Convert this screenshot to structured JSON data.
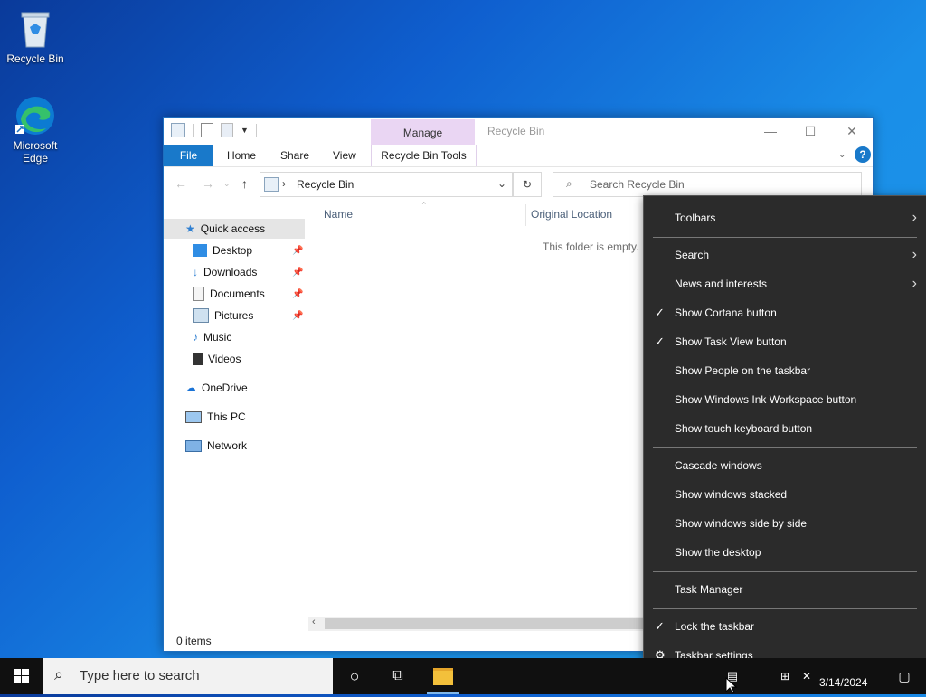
{
  "desktop": {
    "icons": [
      {
        "label": "Recycle Bin"
      },
      {
        "label": "Microsoft Edge"
      }
    ]
  },
  "explorer": {
    "title": "Recycle Bin",
    "manage_tab": "Manage",
    "ribbon_tabs": {
      "file": "File",
      "home": "Home",
      "share": "Share",
      "view": "View",
      "tools": "Recycle Bin Tools"
    },
    "address": "Recycle Bin",
    "search_placeholder": "Search Recycle Bin",
    "nav": {
      "quick_access": "Quick access",
      "desktop": "Desktop",
      "downloads": "Downloads",
      "documents": "Documents",
      "pictures": "Pictures",
      "music": "Music",
      "videos": "Videos",
      "onedrive": "OneDrive",
      "this_pc": "This PC",
      "network": "Network"
    },
    "columns": {
      "name": "Name",
      "original_location": "Original Location"
    },
    "empty_message": "This folder is empty.",
    "status": "0 items"
  },
  "context_menu": {
    "toolbars": "Toolbars",
    "search": "Search",
    "news": "News and interests",
    "cortana": "Show Cortana button",
    "task_view": "Show Task View button",
    "people": "Show People on the taskbar",
    "ink": "Show Windows Ink Workspace button",
    "touch_keyboard": "Show touch keyboard button",
    "cascade": "Cascade windows",
    "stacked": "Show windows stacked",
    "side_by_side": "Show windows side by side",
    "show_desktop": "Show the desktop",
    "task_manager": "Task Manager",
    "lock": "Lock the taskbar",
    "settings": "Taskbar settings"
  },
  "taskbar": {
    "search_placeholder": "Type here to search",
    "date": "3/14/2024"
  }
}
